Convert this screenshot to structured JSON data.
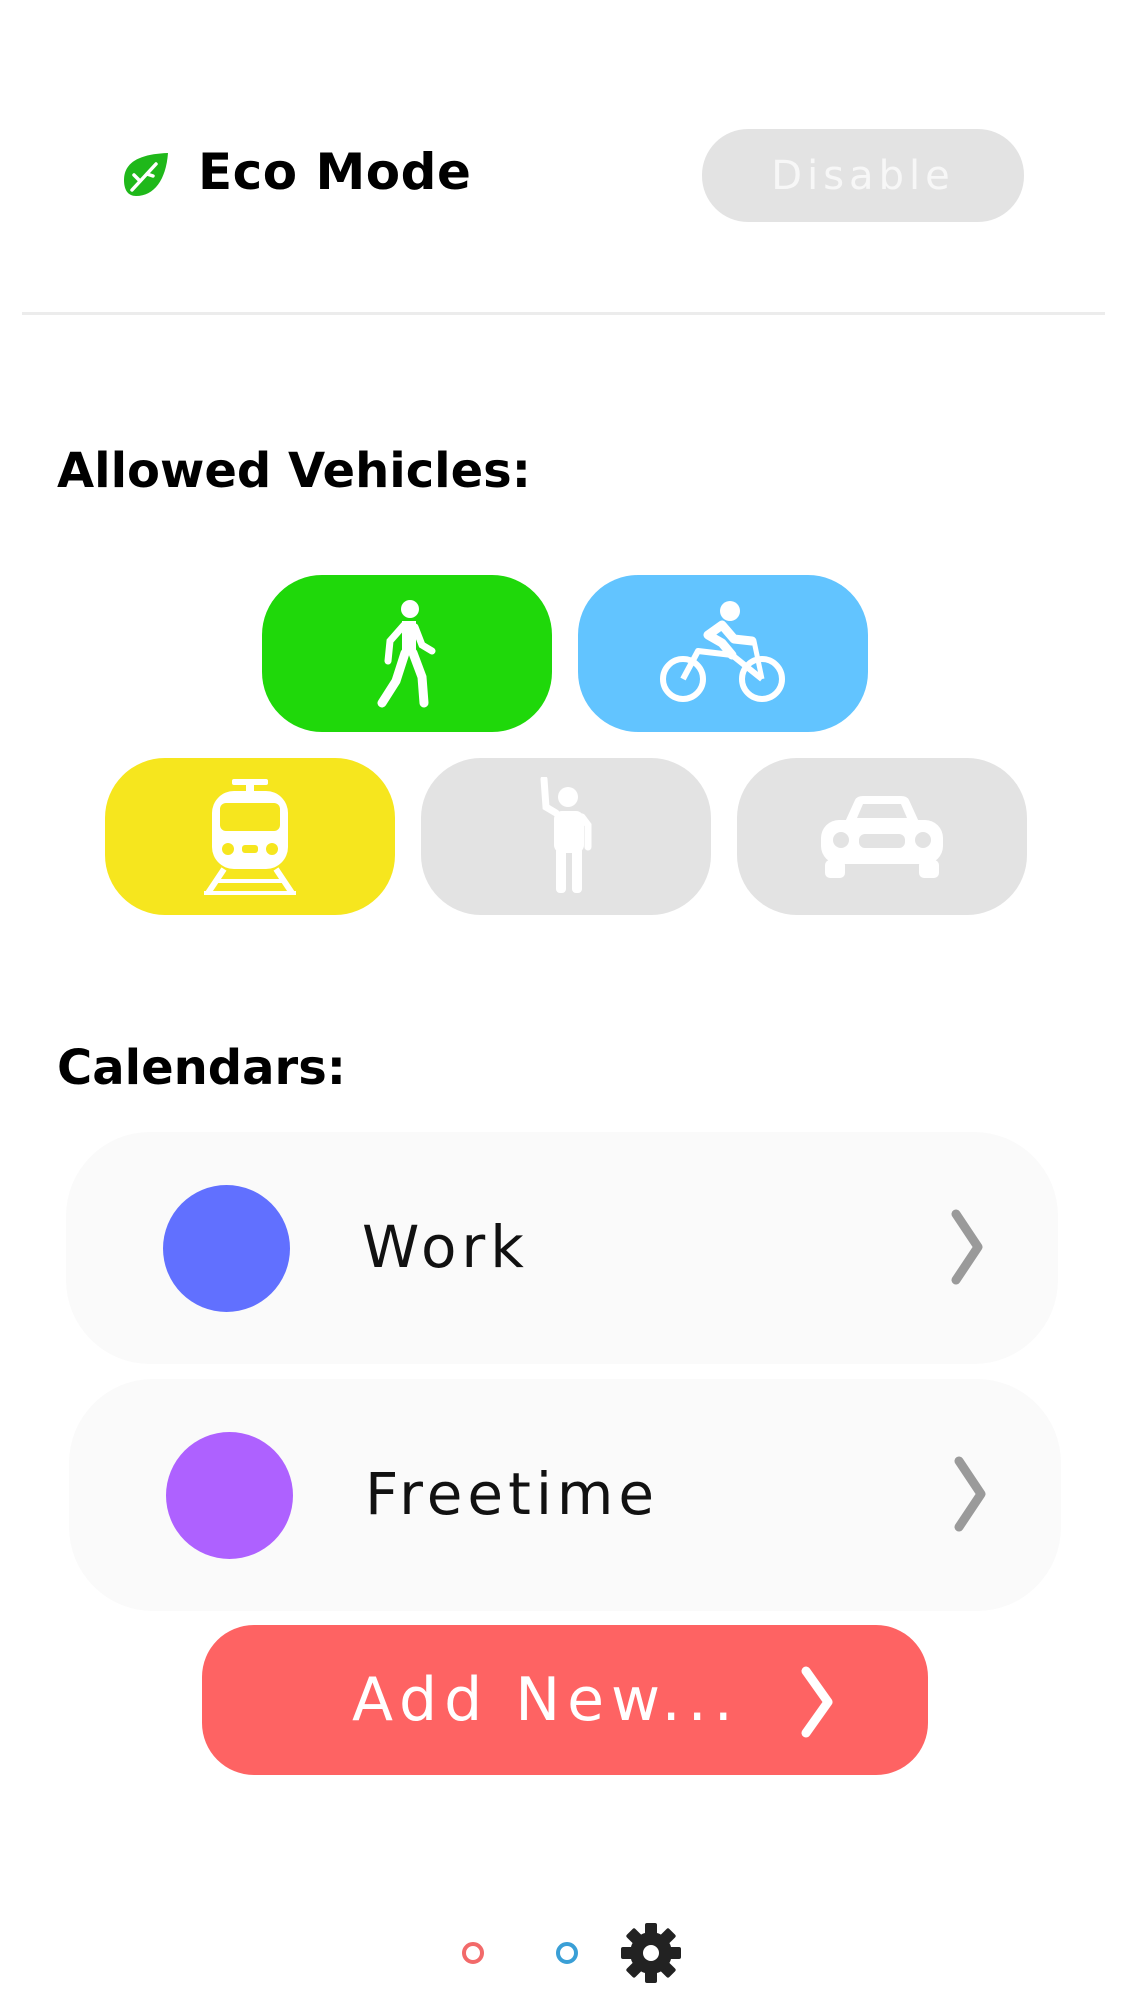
{
  "eco": {
    "title": "Eco Mode",
    "icon": "leaf-icon",
    "toggle_label": "Disable",
    "accent": "#1fb81a"
  },
  "vehicles": {
    "title": "Allowed Vehicles:",
    "items": [
      {
        "name": "walking-icon",
        "enabled": true,
        "color": "#1fd80a"
      },
      {
        "name": "bicycle-icon",
        "enabled": true,
        "color": "#62c4ff"
      },
      {
        "name": "train-icon",
        "enabled": true,
        "color": "#f6e61e"
      },
      {
        "name": "hitchhike-icon",
        "enabled": false,
        "color": "#e3e3e3"
      },
      {
        "name": "car-icon",
        "enabled": false,
        "color": "#e3e3e3"
      }
    ]
  },
  "calendars": {
    "title": "Calendars:",
    "items": [
      {
        "label": "Work",
        "color": "#6170ff"
      },
      {
        "label": "Freetime",
        "color": "#ae61ff"
      }
    ],
    "add_label": "Add New...",
    "add_color": "#fe6363"
  },
  "nav": {
    "dots": [
      "#f26a6a",
      "#3a9fd6"
    ],
    "settings_icon": "gear-icon"
  }
}
